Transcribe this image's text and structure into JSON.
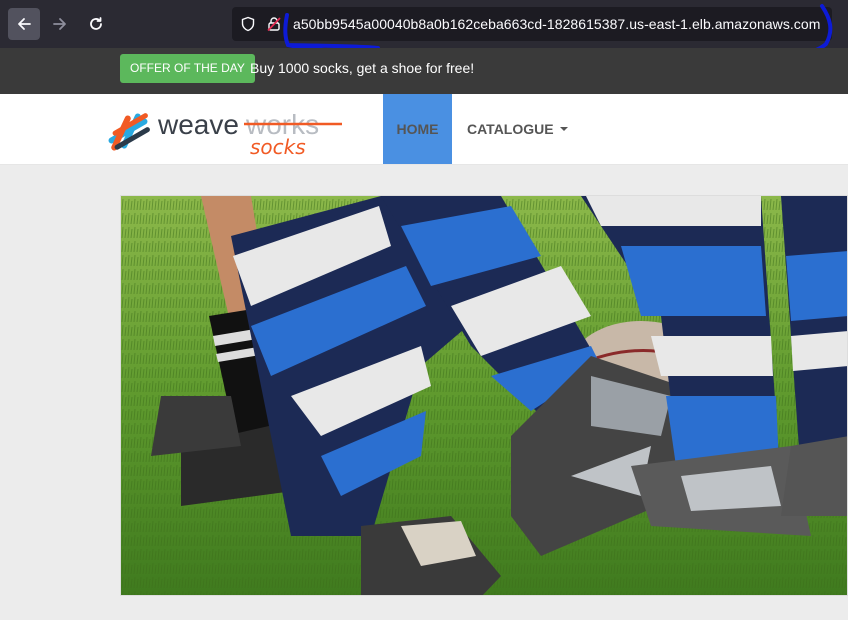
{
  "browser": {
    "url": "a50bb9545a00040b8a0b162ceba663cd-1828615387.us-east-1.elb.amazonaws.com"
  },
  "offer": {
    "badge": "OFFER OF THE DAY",
    "text": "Buy 1000 socks, get a shoe for free!"
  },
  "brand": {
    "name_part1": "weave",
    "name_part2": "works",
    "subtitle": "socks"
  },
  "nav": {
    "home": "HOME",
    "catalogue": "CATALOGUE"
  },
  "colors": {
    "offer_badge": "#5cb85c",
    "nav_active": "#4a90e2",
    "logo_orange": "#f15a24",
    "logo_blue": "#29a9e1"
  }
}
